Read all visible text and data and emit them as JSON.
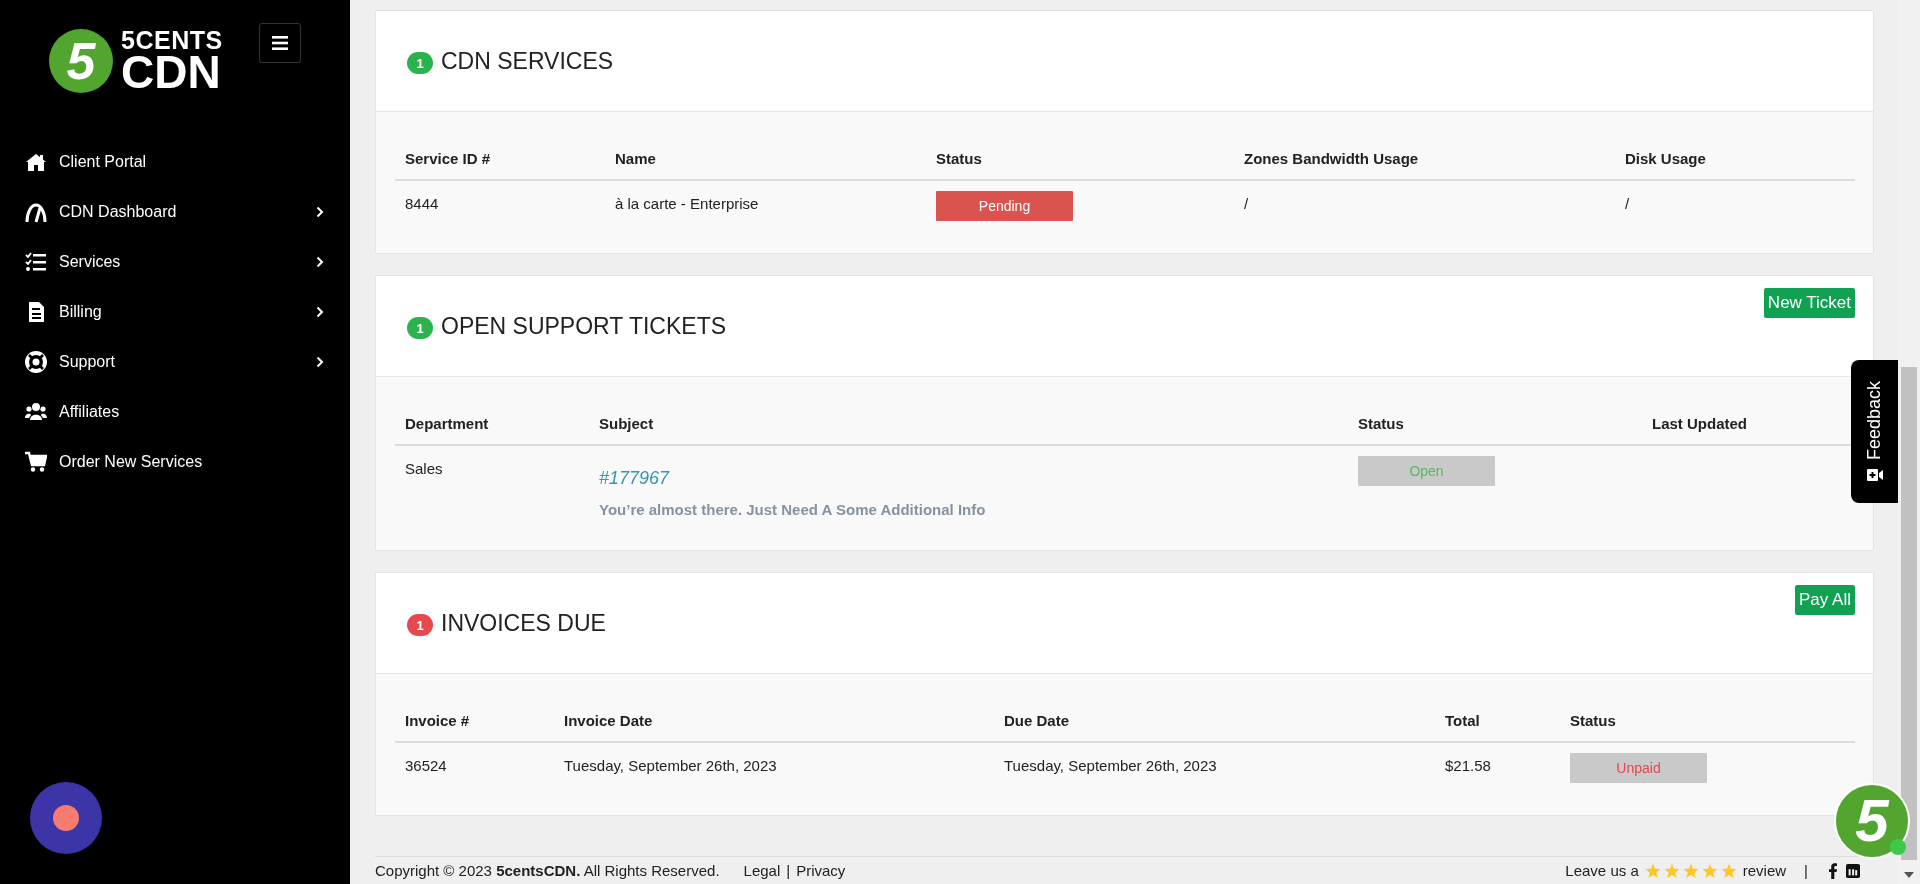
{
  "sidebar": {
    "logo": {
      "mark": "5",
      "top": "5CENTS",
      "bottom": "CDN"
    },
    "items": [
      {
        "label": "Client Portal",
        "submenu": false
      },
      {
        "label": "CDN Dashboard",
        "submenu": true
      },
      {
        "label": "Services",
        "submenu": true
      },
      {
        "label": "Billing",
        "submenu": true
      },
      {
        "label": "Support",
        "submenu": true
      },
      {
        "label": "Affiliates",
        "submenu": false
      },
      {
        "label": "Order New Services",
        "submenu": false
      }
    ]
  },
  "sections": [
    {
      "count": "1",
      "color": "#2bb24c",
      "title": "CDN SERVICES",
      "columns": [
        "Service ID #",
        "Name",
        "Status",
        "Zones Bandwidth Usage",
        "Disk Usage"
      ],
      "rows": [
        [
          {
            "kind": "text",
            "text": "8444"
          },
          {
            "kind": "text",
            "text": "à la carte - Enterprise"
          },
          {
            "kind": "status-filled",
            "text": "Pending",
            "color": "#d9534f"
          },
          {
            "kind": "text",
            "text": "/"
          },
          {
            "kind": "text",
            "text": "/"
          }
        ]
      ]
    },
    {
      "count": "1",
      "color": "#2bb24c",
      "title": "OPEN SUPPORT TICKETS",
      "action": "New Ticket",
      "columns": [
        "Department",
        "Subject",
        "Status",
        "Last Updated"
      ],
      "rows": [
        [
          {
            "kind": "text",
            "text": "Sales"
          },
          {
            "kind": "ticket",
            "link": "#177967",
            "text": "You’re almost there. Just Need A Some Additional Info"
          },
          {
            "kind": "status-muted",
            "text": "Open",
            "color": "#5cb85c"
          },
          {
            "kind": "text",
            "text": ""
          }
        ]
      ]
    },
    {
      "count": "1",
      "color": "#e5484d",
      "title": "INVOICES DUE",
      "action": "Pay All",
      "columns": [
        "Invoice #",
        "Invoice Date",
        "Due Date",
        "Total",
        "Status"
      ],
      "rows": [
        [
          {
            "kind": "text",
            "text": "36524"
          },
          {
            "kind": "text",
            "text": "Tuesday, September 26th, 2023"
          },
          {
            "kind": "text",
            "text": "Tuesday, September 26th, 2023"
          },
          {
            "kind": "text",
            "text": "$21.58"
          },
          {
            "kind": "status-muted",
            "text": "Unpaid",
            "color": "#e5484d"
          }
        ]
      ]
    }
  ],
  "footer": {
    "copyright": "Copyright © 2023 **5centsCDN.** All Rights Reserved.",
    "links": [
      "Legal",
      "Privacy"
    ],
    "link_separator": "|",
    "review": {
      "before": "Leave us a",
      "stars": 5,
      "after": "review"
    },
    "separator": "|"
  },
  "feedback_tab": {
    "label": "Feedback"
  },
  "chat_widget": {
    "mark": "5"
  }
}
